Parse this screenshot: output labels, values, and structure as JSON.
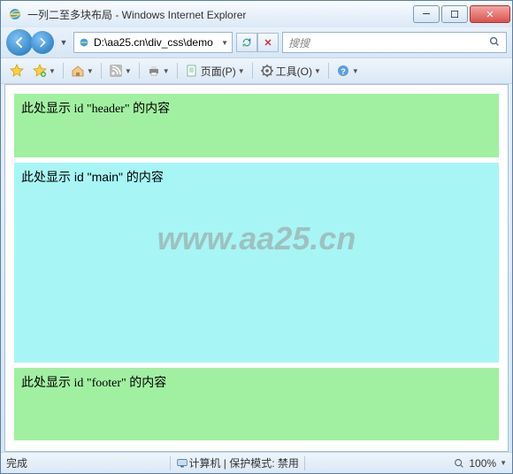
{
  "titlebar": {
    "title": "一列二至多块布局 - Windows Internet Explorer"
  },
  "navbar": {
    "address": "D:\\aa25.cn\\div_css\\demo",
    "search_placeholder": "搜搜"
  },
  "cmdbar": {
    "page_label": "页面(P)",
    "tools_label": "工具(O)"
  },
  "page": {
    "header_text": "此处显示 id \"header\" 的内容",
    "main_text": "此处显示 id \"main\" 的内容",
    "footer_text": "此处显示 id \"footer\" 的内容",
    "watermark": "www.aa25.cn"
  },
  "statusbar": {
    "done": "完成",
    "zone": "计算机",
    "protected": "保护模式: 禁用",
    "zoom": "100%"
  }
}
